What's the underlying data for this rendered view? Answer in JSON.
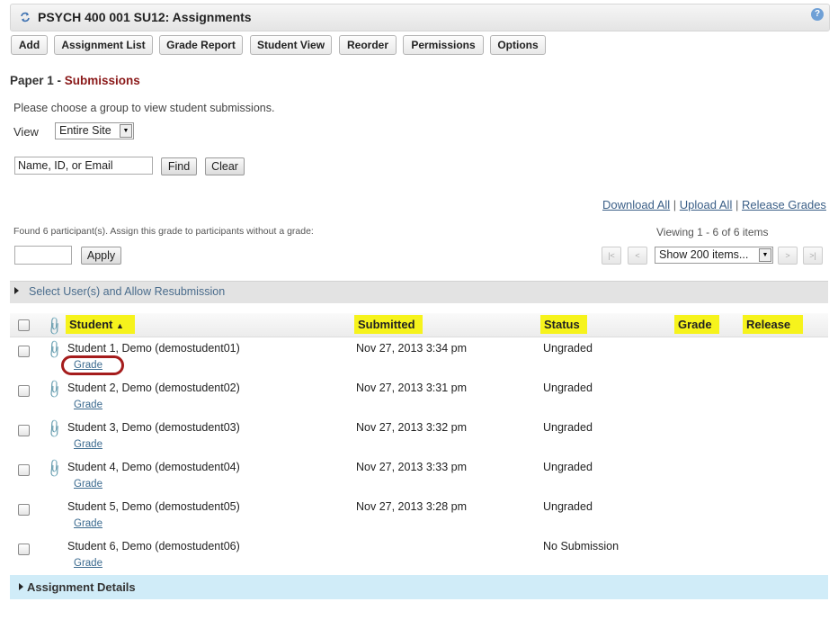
{
  "header": {
    "title": "PSYCH 400 001 SU12: Assignments",
    "help": "?"
  },
  "toolbar": {
    "add": "Add",
    "assignment_list": "Assignment List",
    "grade_report": "Grade Report",
    "student_view": "Student View",
    "reorder": "Reorder",
    "permissions": "Permissions",
    "options": "Options"
  },
  "page": {
    "title_main": "Paper 1 - ",
    "title_sub": "Submissions",
    "instructions": "Please choose a group to view student submissions.",
    "view_label": "View",
    "view_value": "Entire Site"
  },
  "search": {
    "value": "Name, ID, or Email",
    "find": "Find",
    "clear": "Clear"
  },
  "links": {
    "download_all": "Download All",
    "upload_all": "Upload All",
    "release_grades": "Release Grades",
    "separator": "|"
  },
  "grading": {
    "found_text": "Found 6 participant(s). Assign this grade to participants without a grade:",
    "apply": "Apply",
    "viewing": "Viewing 1 - 6 of 6 items",
    "page_size": "Show 200 items...",
    "nav": {
      "first": "|<",
      "prev": "<",
      "next": ">",
      "last": ">|"
    }
  },
  "resubmission": {
    "label": "Select User(s) and Allow Resubmission"
  },
  "table": {
    "headers": {
      "student": "Student",
      "sort_icon": "▲",
      "submitted": "Submitted",
      "status": "Status",
      "grade": "Grade",
      "release": "Release"
    },
    "grade_link": "Grade",
    "rows": [
      {
        "student": "Student 1, Demo (demostudent01)",
        "submitted": "Nov 27, 2013 3:34 pm",
        "status": "Ungraded",
        "attachment": true
      },
      {
        "student": "Student 2, Demo (demostudent02)",
        "submitted": "Nov 27, 2013 3:31 pm",
        "status": "Ungraded",
        "attachment": true
      },
      {
        "student": "Student 3, Demo (demostudent03)",
        "submitted": "Nov 27, 2013 3:32 pm",
        "status": "Ungraded",
        "attachment": true
      },
      {
        "student": "Student 4, Demo (demostudent04)",
        "submitted": "Nov 27, 2013 3:33 pm",
        "status": "Ungraded",
        "attachment": true
      },
      {
        "student": "Student 5, Demo (demostudent05)",
        "submitted": "Nov 27, 2013 3:28 pm",
        "status": "Ungraded",
        "attachment": false
      },
      {
        "student": "Student 6, Demo (demostudent06)",
        "submitted": "",
        "status": "No Submission",
        "attachment": false
      }
    ]
  },
  "details": {
    "label": "Assignment Details"
  },
  "colors": {
    "highlight": "#f6f31c",
    "accent_red": "#8b1a1a",
    "oval": "#a51c1c",
    "details_bg": "#d0ecf8"
  }
}
